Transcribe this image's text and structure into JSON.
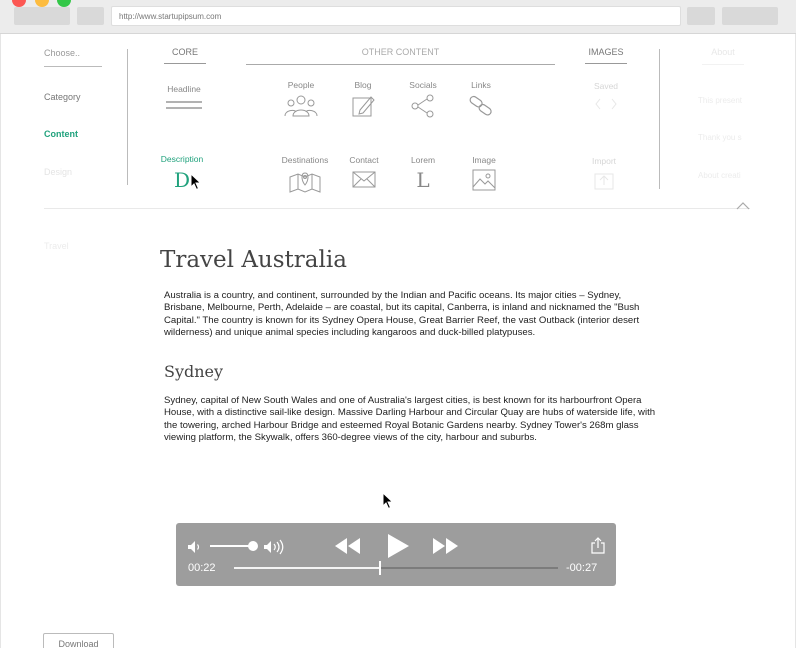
{
  "browser": {
    "url": "http://www.startupipsum.com"
  },
  "sidebar": {
    "choose": "Choose..",
    "items": [
      "Category",
      "Content",
      "Design",
      "Travel"
    ],
    "active_color": "#21a27d"
  },
  "tabs": {
    "core": "CORE",
    "other": "OTHER CONTENT",
    "images": "IMAGES",
    "about": "About"
  },
  "widgets": {
    "headline": "Headline",
    "description": "Description",
    "people": "People",
    "blog": "Blog",
    "socials": "Socials",
    "links": "Links",
    "destinations": "Destinations",
    "contact": "Contact",
    "lorem": "Lorem",
    "image": "Image",
    "saved": "Saved",
    "import": "Import",
    "description_glyph": "D",
    "lorem_glyph": "L"
  },
  "faint_right": [
    "This present",
    "Thank you s",
    "About creati"
  ],
  "article": {
    "title": "Travel Australia",
    "intro": "Australia is a country, and continent, surrounded by the Indian and Pacific oceans. Its major cities – Sydney, Brisbane, Melbourne, Perth, Adelaide – are coastal, but its capital, Canberra, is inland and nicknamed the \"Bush Capital.\" The country is known for its Sydney Opera House, Great Barrier Reef, the vast Outback (interior desert wilderness) and unique animal species including kangaroos and duck-billed platypuses.",
    "section_title": "Sydney",
    "section_body": "Sydney, capital of New South Wales and one of Australia's largest cities, is best known for its harbourfront Opera House, with a distinctive sail-like design. Massive Darling Harbour and Circular Quay are hubs of waterside life, with the towering, arched Harbour Bridge and esteemed Royal Botanic Gardens nearby. Sydney Tower's 268m glass viewing platform, the Skywalk, offers 360-degree views of the city, harbour and suburbs."
  },
  "player": {
    "elapsed": "00:22",
    "remaining": "-00:27",
    "progress_fraction": 0.45,
    "volume_fraction": 0.9
  },
  "download_label": "Download"
}
